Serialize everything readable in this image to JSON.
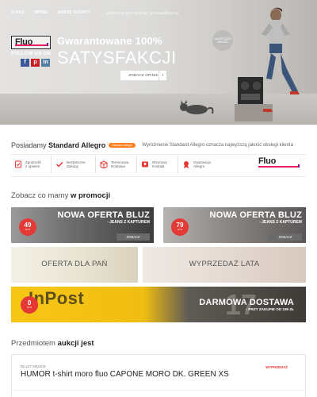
{
  "nav": {
    "items": [
      "O NAS",
      "OPINIE",
      "NASZE OFERTY"
    ],
    "contact": "infolinia 730 502 020  email: sprzedaz@fluo.net"
  },
  "hero": {
    "logo": "Fluo",
    "follow": "FOLLOW US ON",
    "socials": [
      "f",
      "p",
      "in"
    ],
    "headline_1": "Gwarantowane 100%",
    "headline_2": "SATYSFAKCJI",
    "button": "ZOBACZ OPINIE",
    "button_arrow": "›",
    "badge": "NAJWYŻSZA JAKOŚĆ"
  },
  "standard": {
    "title_prefix": "Posiadamy ",
    "title_bold": "Standard Allegro",
    "pill": "Standard Allegro",
    "description": "Wyróżnienie Standard Allegro oznacza najwyższą jakość obsługi klienta",
    "features": [
      {
        "label1": "Zgodność",
        "label2": "z opisem",
        "icon": "document-check-icon"
      },
      {
        "label1": "Bezpieczne",
        "label2": "Zakupy",
        "icon": "checkmark-icon"
      },
      {
        "label1": "Terminowa",
        "label2": "Dostawa",
        "icon": "delivery-box-icon"
      },
      {
        "label1": "Wzorowy",
        "label2": "Kontakt",
        "icon": "contact-icon"
      },
      {
        "label1": "Gwarancja",
        "label2": "Allegro",
        "icon": "award-icon"
      }
    ],
    "logo": "Fluo"
  },
  "promo": {
    "title_prefix": "Zobacz co mamy ",
    "title_bold": "w promocji",
    "banner1": {
      "title": "NOWA OFERTA BLUZ",
      "sub": "- JEANS Z KAPTUREM",
      "cta": "ZOBACZ",
      "price": "49",
      "currency": "PLN"
    },
    "banner2": {
      "title": "NOWA OFERTA BLUZ",
      "sub": "- JEANS Z KAPTUREM",
      "cta": "ZOBACZ",
      "price": "79",
      "currency": "PLN"
    },
    "banner3": {
      "title": "OFERTA DLA PAŃ"
    },
    "banner4": {
      "title": "WYPRZEDAŻ LATA"
    },
    "banner5": {
      "brand": "InPost",
      "big": "17",
      "title": "DARMOWA DOSTAWA",
      "sub": "- PRZY ZAKUPIE OD 199 ZŁ",
      "price": "0",
      "currency": "PLN"
    }
  },
  "auction": {
    "title_prefix": "Przedmiotem ",
    "title_bold": "aukcji jest",
    "category": "BLUZY MĘSKIE",
    "name": "HUMOR t-shirt moro fluo CAPONE MORO DK. GREEN XS",
    "promo_label": "WYPRZEDAŻ"
  }
}
